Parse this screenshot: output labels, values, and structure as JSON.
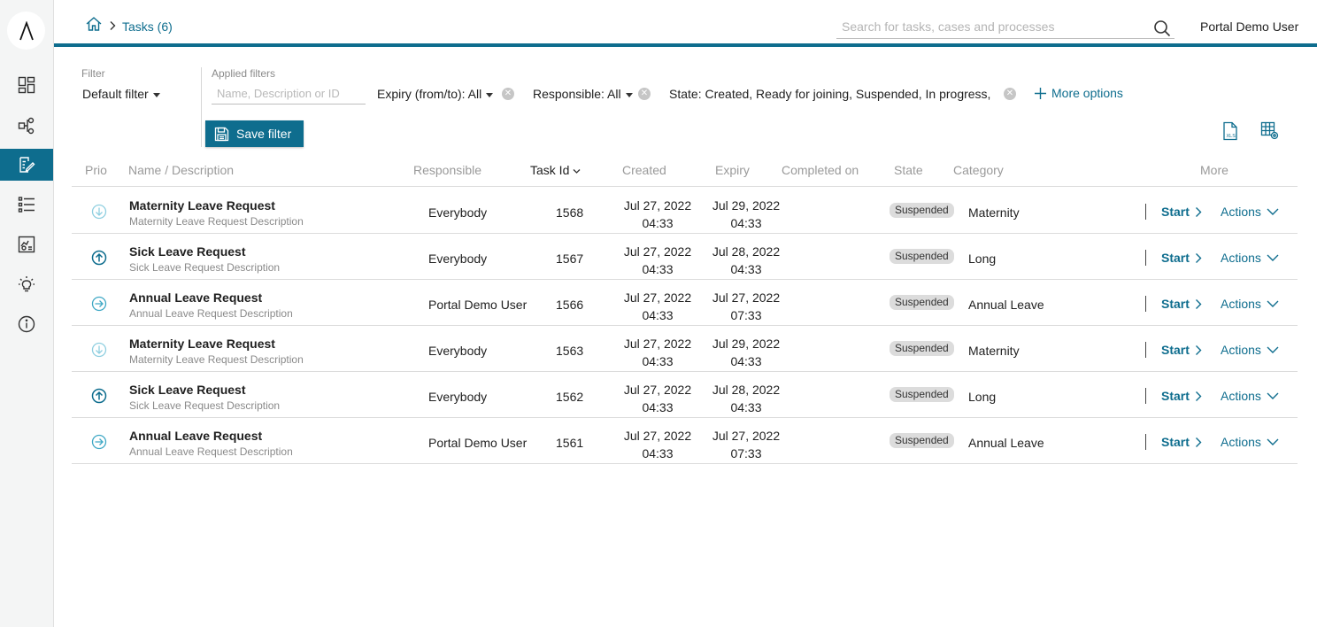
{
  "header": {
    "breadcrumb": "Tasks (6)",
    "search_placeholder": "Search for tasks, cases and processes",
    "user": "Portal Demo User"
  },
  "sidebar": {
    "items": [
      "dashboard-icon",
      "processes-icon",
      "tasks-icon",
      "cases-icon",
      "statistics-icon",
      "ideas-icon",
      "info-icon"
    ],
    "active": "tasks-icon"
  },
  "filter": {
    "label": "Filter",
    "selected": "Default filter",
    "applied_label": "Applied filters",
    "applied_placeholder": "Name, Description or ID",
    "expiry": "Expiry (from/to): All",
    "responsible": "Responsible: All",
    "state": "State: Created, Ready for joining, Suspended, In progress,",
    "more_options": "More options",
    "save_filter": "Save filter"
  },
  "table": {
    "columns": {
      "prio": "Prio",
      "name": "Name / Description",
      "responsible": "Responsible",
      "task_id": "Task Id",
      "created": "Created",
      "expiry": "Expiry",
      "completed": "Completed on",
      "state": "State",
      "category": "Category",
      "more": "More"
    },
    "start_label": "Start",
    "actions_label": "Actions",
    "rows": [
      {
        "prio": "low",
        "name": "Maternity Leave Request",
        "desc": "Maternity Leave Request Description",
        "responsible": "Everybody",
        "id": "1568",
        "created_date": "Jul 27, 2022",
        "created_time": "04:33",
        "expiry_date": "Jul 29, 2022",
        "expiry_time": "04:33",
        "state": "Suspended",
        "category": "Maternity"
      },
      {
        "prio": "high",
        "name": "Sick Leave Request",
        "desc": "Sick Leave Request Description",
        "responsible": "Everybody",
        "id": "1567",
        "created_date": "Jul 27, 2022",
        "created_time": "04:33",
        "expiry_date": "Jul 28, 2022",
        "expiry_time": "04:33",
        "state": "Suspended",
        "category": "Long"
      },
      {
        "prio": "normal",
        "name": "Annual Leave Request",
        "desc": "Annual Leave Request Description",
        "responsible": "Portal Demo User",
        "id": "1566",
        "created_date": "Jul 27, 2022",
        "created_time": "04:33",
        "expiry_date": "Jul 27, 2022",
        "expiry_time": "07:33",
        "state": "Suspended",
        "category": "Annual Leave"
      },
      {
        "prio": "low",
        "name": "Maternity Leave Request",
        "desc": "Maternity Leave Request Description",
        "responsible": "Everybody",
        "id": "1563",
        "created_date": "Jul 27, 2022",
        "created_time": "04:33",
        "expiry_date": "Jul 29, 2022",
        "expiry_time": "04:33",
        "state": "Suspended",
        "category": "Maternity"
      },
      {
        "prio": "high",
        "name": "Sick Leave Request",
        "desc": "Sick Leave Request Description",
        "responsible": "Everybody",
        "id": "1562",
        "created_date": "Jul 27, 2022",
        "created_time": "04:33",
        "expiry_date": "Jul 28, 2022",
        "expiry_time": "04:33",
        "state": "Suspended",
        "category": "Long"
      },
      {
        "prio": "normal",
        "name": "Annual Leave Request",
        "desc": "Annual Leave Request Description",
        "responsible": "Portal Demo User",
        "id": "1561",
        "created_date": "Jul 27, 2022",
        "created_time": "04:33",
        "expiry_date": "Jul 27, 2022",
        "expiry_time": "07:33",
        "state": "Suspended",
        "category": "Annual Leave"
      }
    ]
  },
  "colors": {
    "accent": "#0e6d8e",
    "low_prio": "#8fcfe0"
  }
}
